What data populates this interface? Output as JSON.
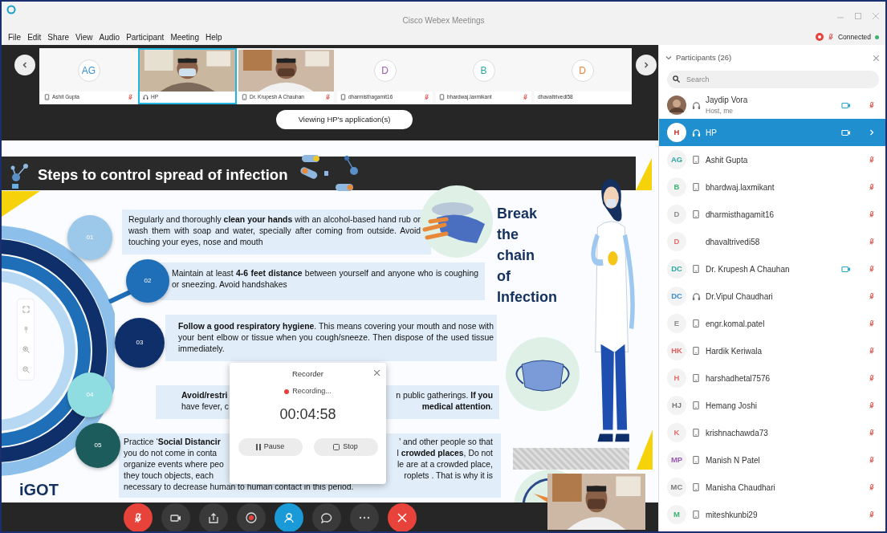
{
  "window": {
    "title": "Cisco Webex Meetings"
  },
  "menu": [
    "File",
    "Edit",
    "Share",
    "View",
    "Audio",
    "Participant",
    "Meeting",
    "Help"
  ],
  "connection": {
    "label": "Connected"
  },
  "video_strip": [
    {
      "name": "Ashit Gupta",
      "kind": "avatar",
      "initials": "AG",
      "color": "#3a8fd0",
      "device": {
        "kind": "phone"
      },
      "muted": true,
      "selected": false
    },
    {
      "name": "HP",
      "kind": "video",
      "device": {
        "kind": "headset"
      },
      "muted": false,
      "selected": true
    },
    {
      "name": "Dr. Krupesh A Chauhan",
      "kind": "video",
      "device": {
        "kind": "phone"
      },
      "muted": true,
      "selected": false
    },
    {
      "name": "dharmisthagamit16",
      "kind": "avatar",
      "initials": "D",
      "color": "#9b59b6",
      "device": {
        "kind": "phone"
      },
      "muted": true,
      "selected": false
    },
    {
      "name": "bhardwaj.laxmikant",
      "kind": "avatar",
      "initials": "B",
      "color": "#2aa8a0",
      "device": {
        "kind": "phone"
      },
      "muted": true,
      "selected": false
    },
    {
      "name": "dhavaltrivedi58",
      "kind": "avatar",
      "initials": "D",
      "color": "#e8833a",
      "muted": false,
      "selected": false
    }
  ],
  "banner": "Viewing HP's application(s)",
  "slide": {
    "title": "Steps to control spread of infection",
    "slogan": "Break the chain of Infection",
    "logo": "iGOT",
    "steps": [
      {
        "number": "01",
        "kind": "paragraph",
        "color": "#9cc8ea",
        "text": "Regularly and thoroughly **clean your hands** with an alcohol-based hand rub or wash them with soap and water, specially after coming from outside. Avoid touching your eyes, nose and mouth"
      },
      {
        "number": "02",
        "kind": "paragraph",
        "color": "#1e6fb8",
        "text": "Maintain at least **4-6 feet distance** between yourself and anyone who is coughing or sneezing. Avoid handshakes"
      },
      {
        "number": "03",
        "kind": "paragraph",
        "color": "#0f2f6a",
        "text": "**Follow a good respiratory hygiene**. This means covering your mouth and nose with your bent elbow or tissue when you cough/sneeze. Then dispose of the used tissue immediately."
      },
      {
        "number": "04",
        "kind": "fragments",
        "color": "#8fdde0",
        "lines": [
          {
            "left": "**Avoid/restri**",
            "right": "n public gatherings. **If you**"
          },
          {
            "left": "have fever, c",
            "right": "**medical attention**."
          }
        ]
      },
      {
        "number": "05",
        "kind": "fragments",
        "color": "#1d5c5c",
        "lines": [
          {
            "left": "Practice ‘**Social Distancir**",
            "right": "’ and other people so that"
          },
          {
            "left": "you do not come in conta",
            "right": "l **crowded places**, Do not"
          },
          {
            "left": "organize events where peo",
            "right": "le are at a crowded place,"
          },
          {
            "left": "they touch objects, each",
            "right": "roplets . That is why it is"
          },
          {
            "left": "necessary to decrease human to human contact in this period."
          }
        ]
      }
    ]
  },
  "recorder": {
    "title": "Recorder",
    "status": "Recording...",
    "time": "00:04:58",
    "buttons": [
      {
        "label": "Pause",
        "kind": "pause"
      },
      {
        "label": "Stop",
        "kind": "stop"
      }
    ]
  },
  "controls": [
    {
      "kind": "mute",
      "selected": false
    },
    {
      "kind": "video",
      "selected": false
    },
    {
      "kind": "share",
      "selected": false
    },
    {
      "kind": "record",
      "selected": false
    },
    {
      "kind": "participants",
      "selected": true
    },
    {
      "kind": "chat",
      "selected": false
    },
    {
      "kind": "more",
      "selected": false
    },
    {
      "kind": "leave",
      "selected": false
    }
  ],
  "participants": {
    "title": "Participants (26)",
    "search_placeholder": "Search",
    "rows": [
      {
        "name": "Jaydip Vora",
        "subtitle": "Host, me",
        "device": {
          "kind": "headset"
        },
        "video": true,
        "muted": true,
        "selected": false
      },
      {
        "name": "HP",
        "kind": "initials",
        "initials": "H",
        "color": "#c0392b",
        "device": {
          "kind": "headset"
        },
        "video": true,
        "muted": false,
        "selected": true
      },
      {
        "name": "Ashit Gupta",
        "kind": "initials",
        "initials": "AG",
        "color": "#2aa8a0",
        "device": {
          "kind": "phone"
        },
        "video": false,
        "muted": true,
        "selected": false
      },
      {
        "name": "bhardwaj.laxmikant",
        "kind": "initials",
        "initials": "B",
        "color": "#3cb371",
        "device": {
          "kind": "phone"
        },
        "video": false,
        "muted": true,
        "selected": false
      },
      {
        "name": "dharmisthagamit16",
        "kind": "initials",
        "initials": "D",
        "color": "#8e8e8e",
        "device": {
          "kind": "phone"
        },
        "video": false,
        "muted": true,
        "selected": false
      },
      {
        "name": "dhavaltrivedi58",
        "kind": "initials",
        "initials": "D",
        "color": "#e07070",
        "video": false,
        "muted": true,
        "selected": false
      },
      {
        "name": "Dr. Krupesh A Chauhan",
        "kind": "initials",
        "initials": "DC",
        "color": "#2aa8a0",
        "device": {
          "kind": "phone"
        },
        "video": true,
        "muted": true,
        "selected": false
      },
      {
        "name": "Dr.Vipul Chaudhari",
        "kind": "initials",
        "initials": "DC",
        "color": "#3a8fd0",
        "device": {
          "kind": "headset"
        },
        "video": false,
        "muted": true,
        "selected": false
      },
      {
        "name": "engr.komal.patel",
        "kind": "initials",
        "initials": "E",
        "color": "#8e8e8e",
        "device": {
          "kind": "phone"
        },
        "video": false,
        "muted": true,
        "selected": false
      },
      {
        "name": "Hardik Keriwala",
        "kind": "initials",
        "initials": "HK",
        "color": "#e06060",
        "device": {
          "kind": "phone"
        },
        "video": false,
        "muted": true,
        "selected": false
      },
      {
        "name": "harshadhetal7576",
        "kind": "initials",
        "initials": "H",
        "color": "#e07070",
        "device": {
          "kind": "phone"
        },
        "video": false,
        "muted": true,
        "selected": false
      },
      {
        "name": "Hemang Joshi",
        "kind": "initials",
        "initials": "HJ",
        "color": "#7a7a7a",
        "device": {
          "kind": "phone"
        },
        "video": false,
        "muted": true,
        "selected": false
      },
      {
        "name": "krishnachawda73",
        "kind": "initials",
        "initials": "K",
        "color": "#e07070",
        "device": {
          "kind": "phone"
        },
        "video": false,
        "muted": true,
        "selected": false
      },
      {
        "name": "Manish N Patel",
        "kind": "initials",
        "initials": "MP",
        "color": "#9b59b6",
        "device": {
          "kind": "phone"
        },
        "video": false,
        "muted": true,
        "selected": false
      },
      {
        "name": "Manisha Chaudhari",
        "kind": "initials",
        "initials": "MC",
        "color": "#7a7a7a",
        "device": {
          "kind": "phone"
        },
        "video": false,
        "muted": true,
        "selected": false
      },
      {
        "name": "miteshkunbi29",
        "kind": "initials",
        "initials": "M",
        "color": "#3cb371",
        "device": {
          "kind": "phone"
        },
        "video": false,
        "muted": true,
        "selected": false
      }
    ]
  }
}
